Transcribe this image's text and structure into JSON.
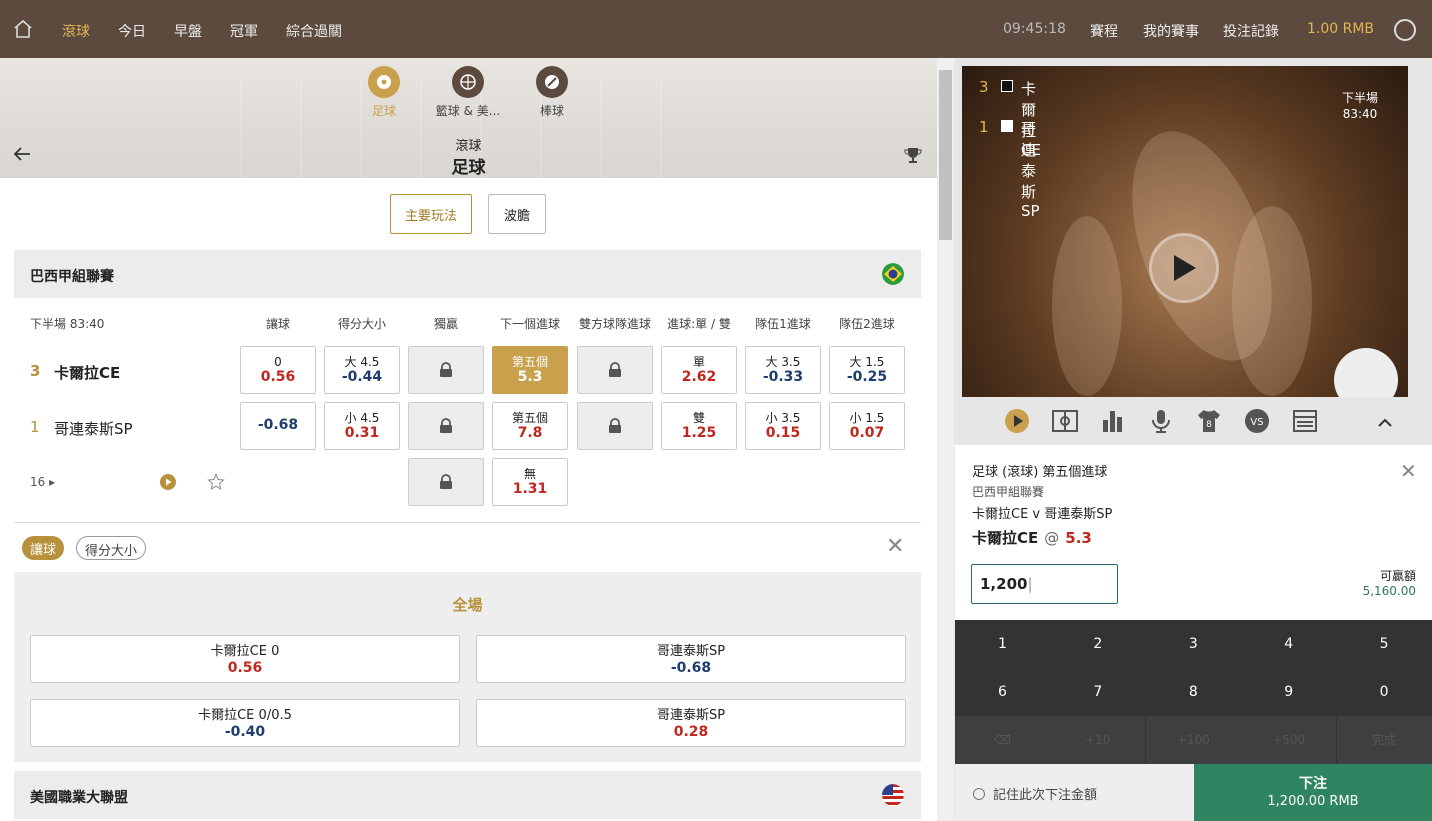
{
  "topbar": {
    "nav": [
      "滾球",
      "今日",
      "早盤",
      "冠軍",
      "綜合過關"
    ],
    "time": "09:45:18",
    "links": [
      "賽程",
      "我的賽事",
      "投注記錄"
    ],
    "balance": "1.00 RMB"
  },
  "sports": [
    {
      "label": "足球",
      "icon": "soccer-icon"
    },
    {
      "label": "籃球 & 美...",
      "icon": "basketball-icon"
    },
    {
      "label": "棒球",
      "icon": "baseball-icon"
    }
  ],
  "page": {
    "subtitle": "滾球",
    "title": "足球"
  },
  "tabs": [
    "主要玩法",
    "波膽"
  ],
  "league": {
    "name": "巴西甲組聯賽",
    "status": "下半場 83:40",
    "more": "16"
  },
  "headers": [
    "讓球",
    "得分大小",
    "獨贏",
    "下一個進球",
    "雙方球隊進球",
    "進球:單 / 雙",
    "隊伍1進球",
    "隊伍2進球"
  ],
  "teams": [
    {
      "score": "3",
      "name": "卡爾拉CE"
    },
    {
      "score": "1",
      "name": "哥連泰斯SP"
    }
  ],
  "odds": {
    "r1": [
      {
        "t": "0",
        "v": "0.56",
        "c": "red"
      },
      {
        "t": "大 4.5",
        "v": "-0.44",
        "c": "blue"
      },
      {
        "lock": true
      },
      {
        "t": "第五個",
        "v": "5.3",
        "hi": true
      },
      {
        "lock": true
      },
      {
        "t": "單",
        "v": "2.62",
        "c": "red"
      },
      {
        "t": "大 3.5",
        "v": "-0.33",
        "c": "blue"
      },
      {
        "t": "大 1.5",
        "v": "-0.25",
        "c": "blue"
      }
    ],
    "r2": [
      {
        "t": "",
        "v": "-0.68",
        "c": "blue"
      },
      {
        "t": "小 4.5",
        "v": "0.31",
        "c": "red"
      },
      {
        "lock": true
      },
      {
        "t": "第五個",
        "v": "7.8",
        "c": "red"
      },
      {
        "lock": true
      },
      {
        "t": "雙",
        "v": "1.25",
        "c": "red"
      },
      {
        "t": "小 3.5",
        "v": "0.15",
        "c": "red"
      },
      {
        "t": "小 1.5",
        "v": "0.07",
        "c": "red"
      }
    ],
    "r3": [
      {
        "lock": true
      },
      {
        "t": "無",
        "v": "1.31",
        "c": "red"
      }
    ]
  },
  "chips": [
    "讓球",
    "得分大小"
  ],
  "sub": {
    "title": "全場",
    "items": [
      {
        "t": "卡爾拉CE",
        "h": "0",
        "v": "0.56",
        "c": "red"
      },
      {
        "t": "哥連泰斯SP",
        "h": "",
        "v": "-0.68",
        "c": "blue"
      },
      {
        "t": "卡爾拉CE",
        "h": "0/0.5",
        "v": "-0.40",
        "c": "blue"
      },
      {
        "t": "哥連泰斯SP",
        "h": "",
        "v": "0.28",
        "c": "red"
      }
    ]
  },
  "league2": {
    "name": "美國職業大聯盟"
  },
  "video": {
    "period": "下半場",
    "clock": "83:40"
  },
  "slip": {
    "market": "足球 (滾球) 第五個進球",
    "league": "巴西甲組聯賽",
    "match": "卡爾拉CE v 哥連泰斯SP",
    "pick": "卡爾拉CE",
    "at": "@",
    "odds": "5.3",
    "stake": "1,200",
    "max_label": "可贏額",
    "max_value": "5,160.00",
    "remember": "記住此次下注金額",
    "submit": "下注",
    "submit_amount": "1,200.00 RMB"
  },
  "keypad": [
    "1",
    "2",
    "3",
    "4",
    "5",
    "6",
    "7",
    "8",
    "9",
    "0",
    "⌫",
    "+10",
    "+100",
    "+500",
    "完成"
  ]
}
